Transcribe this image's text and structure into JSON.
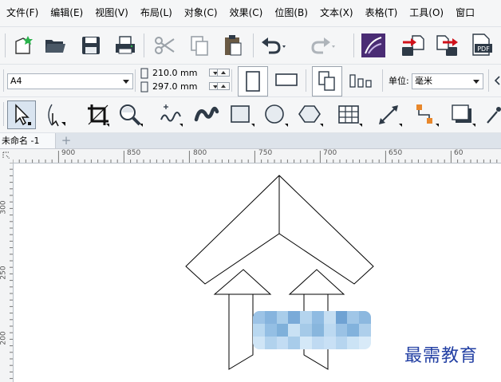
{
  "menu": [
    "文件(F)",
    "编辑(E)",
    "视图(V)",
    "布局(L)",
    "对象(C)",
    "效果(C)",
    "位图(B)",
    "文本(X)",
    "表格(T)",
    "工具(O)",
    "窗口"
  ],
  "property_bar": {
    "page_size": "A4",
    "width": "210.0 mm",
    "height": "297.0 mm",
    "units_label": "单位:",
    "units_value": "毫米"
  },
  "document_tab": "未命名 -1",
  "add_tab": "+",
  "ruler": {
    "horizontal": [
      "900",
      "850",
      "800",
      "750",
      "700",
      "650",
      "60"
    ],
    "vertical": [
      "300",
      "250",
      "200"
    ]
  },
  "icons": {
    "standard": [
      "new-document-icon",
      "open-folder-icon",
      "save-icon",
      "print-icon",
      "cut-icon",
      "copy-icon",
      "paste-icon",
      "undo-icon",
      "redo-icon",
      "app-launcher-icon",
      "import-icon",
      "export-icon",
      "publish-pdf-icon"
    ],
    "toolbox": [
      "pick-tool-icon",
      "shape-tool-icon",
      "crop-tool-icon",
      "zoom-tool-icon",
      "freehand-tool-icon",
      "artistic-media-icon",
      "rectangle-tool-icon",
      "ellipse-tool-icon",
      "polygon-tool-icon",
      "table-tool-icon",
      "dimension-tool-icon",
      "connector-tool-icon",
      "drop-shadow-tool-icon"
    ]
  },
  "watermark": "最需教育"
}
